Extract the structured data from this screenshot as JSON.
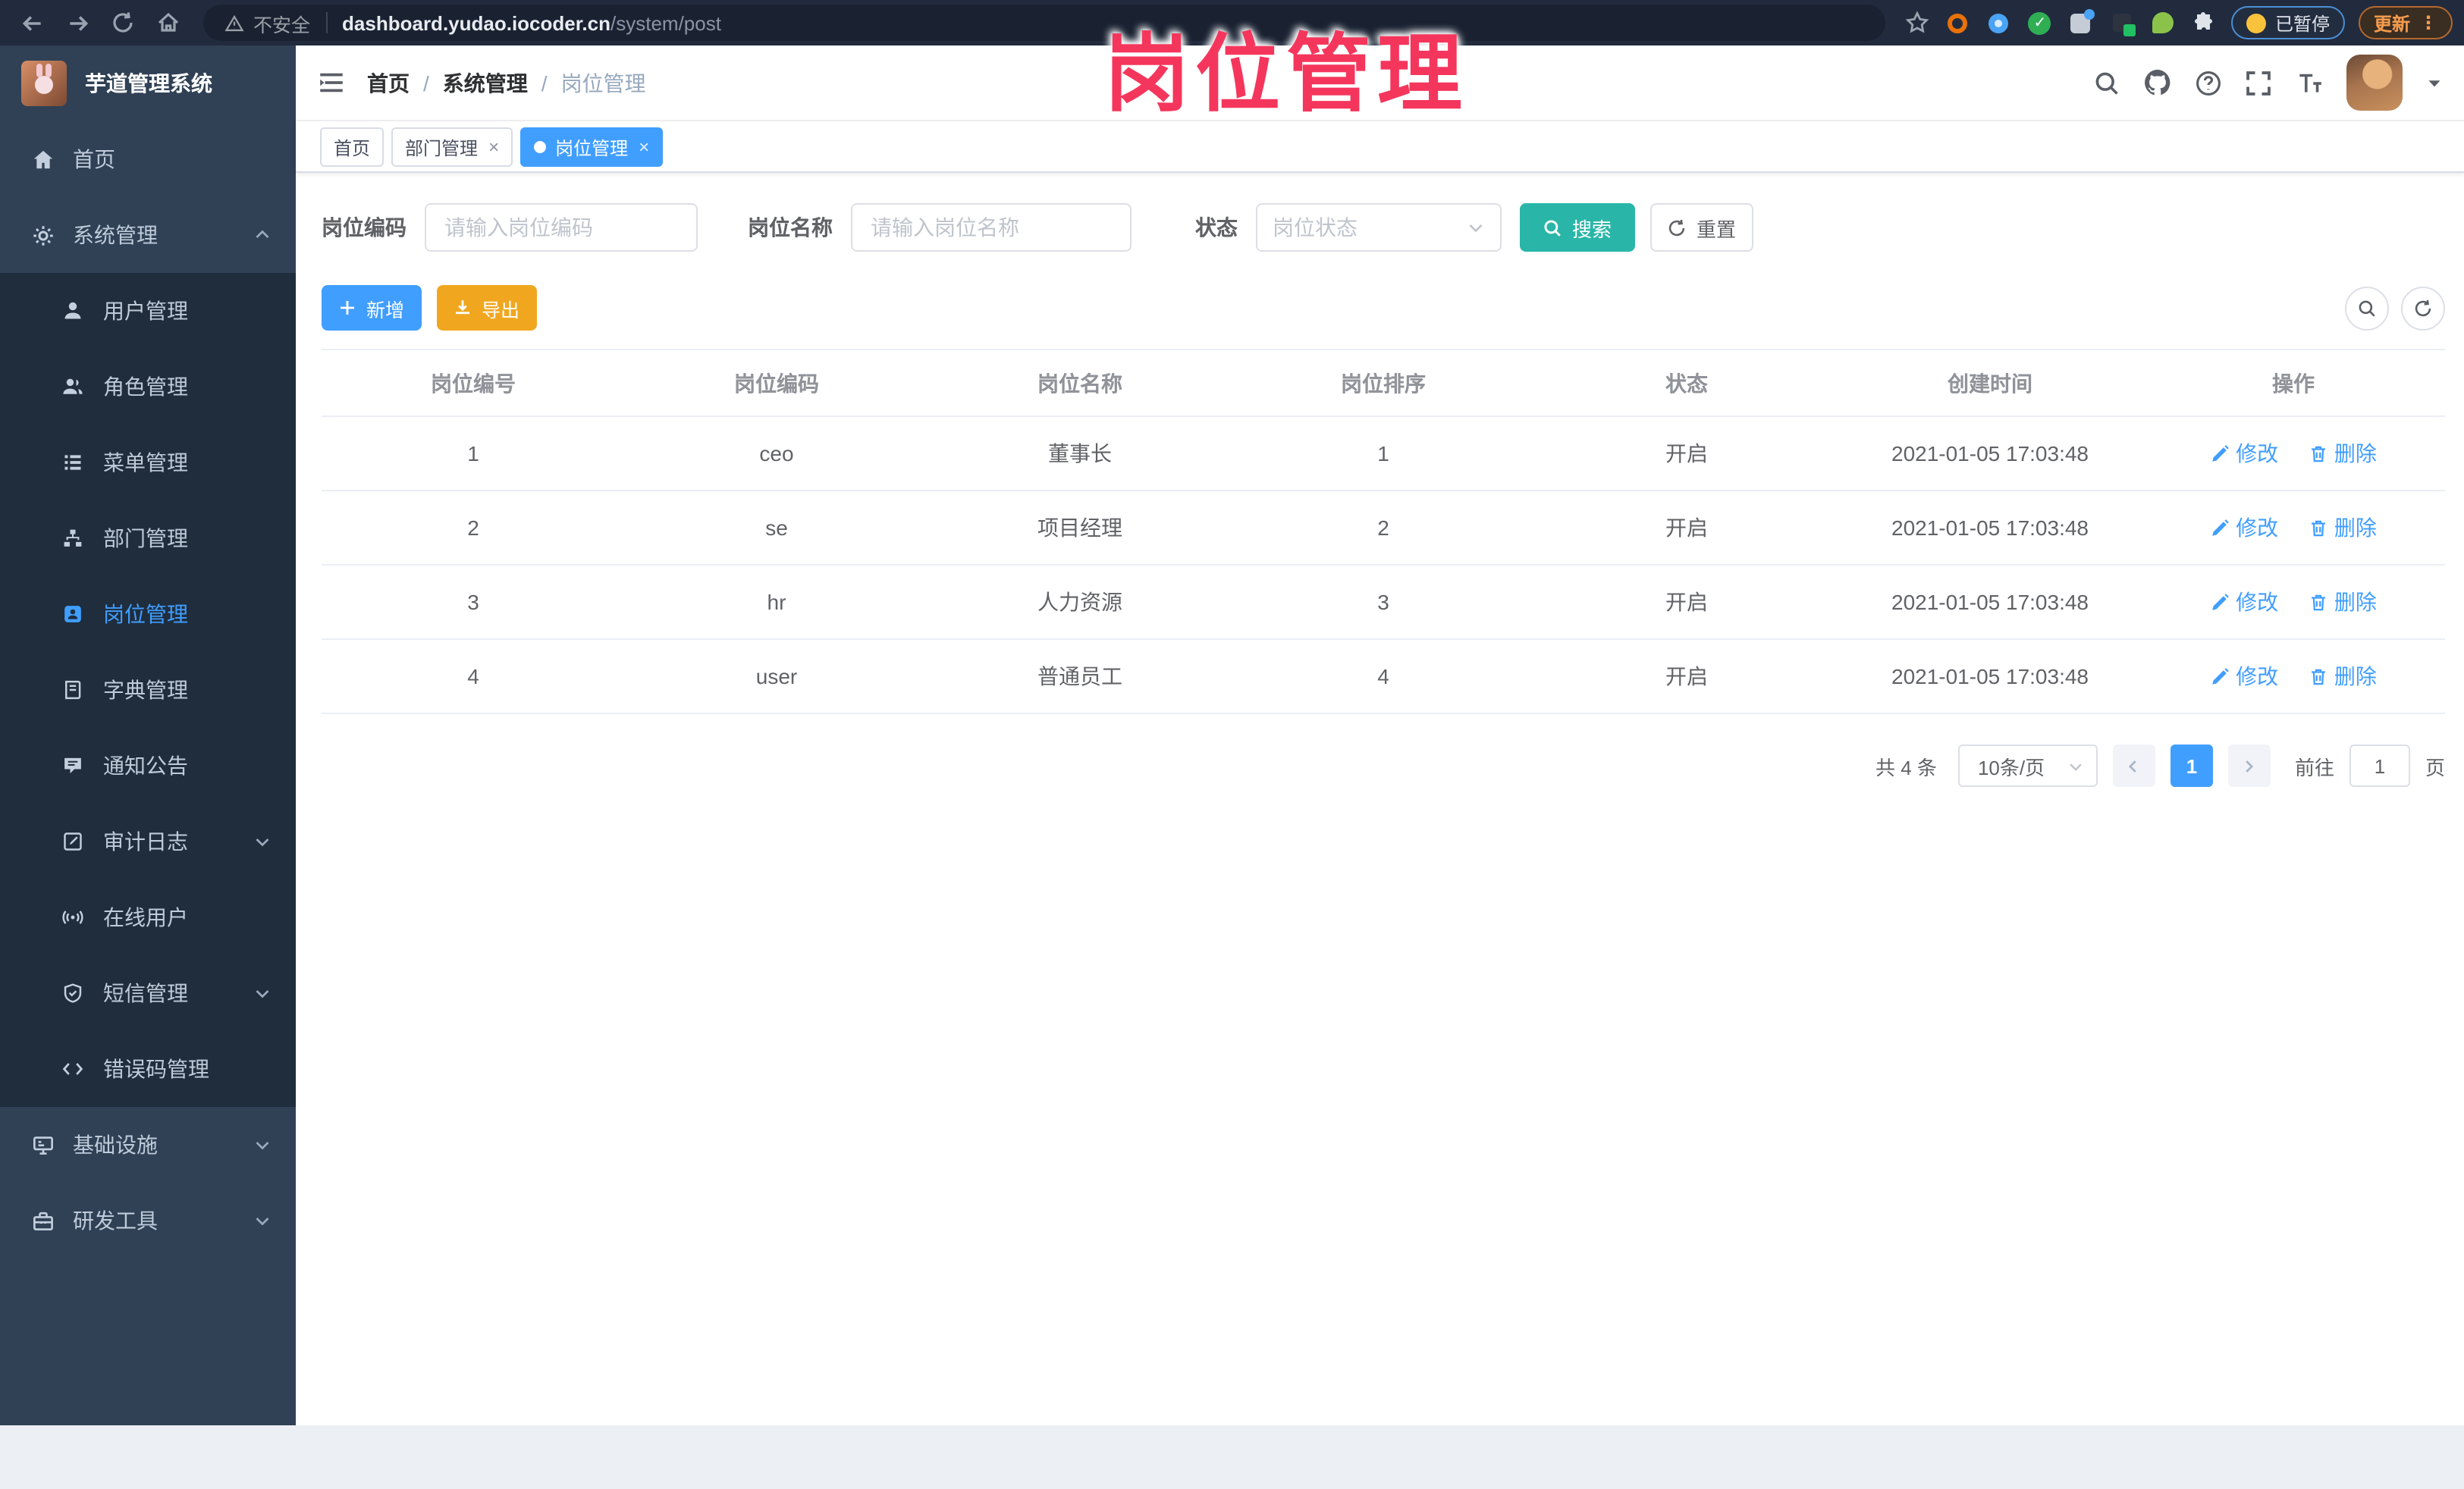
{
  "browser": {
    "security_label": "不安全",
    "url_host": "dashboard.yudao.iocoder.cn",
    "url_path": "/system/post",
    "paused_label": "已暂停",
    "update_label": "更新"
  },
  "annotation": {
    "text": "岗位管理"
  },
  "sidebar": {
    "title": "芋道管理系统",
    "items": [
      {
        "label": "首页"
      },
      {
        "label": "系统管理"
      },
      {
        "label": "用户管理"
      },
      {
        "label": "角色管理"
      },
      {
        "label": "菜单管理"
      },
      {
        "label": "部门管理"
      },
      {
        "label": "岗位管理"
      },
      {
        "label": "字典管理"
      },
      {
        "label": "通知公告"
      },
      {
        "label": "审计日志"
      },
      {
        "label": "在线用户"
      },
      {
        "label": "短信管理"
      },
      {
        "label": "错误码管理"
      },
      {
        "label": "基础设施"
      },
      {
        "label": "研发工具"
      }
    ]
  },
  "breadcrumb": {
    "items": [
      "首页",
      "系统管理",
      "岗位管理"
    ]
  },
  "tabs": [
    {
      "label": "首页"
    },
    {
      "label": "部门管理"
    },
    {
      "label": "岗位管理"
    }
  ],
  "filters": {
    "code_label": "岗位编码",
    "code_placeholder": "请输入岗位编码",
    "name_label": "岗位名称",
    "name_placeholder": "请输入岗位名称",
    "status_label": "状态",
    "status_placeholder": "岗位状态",
    "search_label": "搜索",
    "reset_label": "重置"
  },
  "toolbar": {
    "add_label": "新增",
    "export_label": "导出"
  },
  "table": {
    "headers": [
      "岗位编号",
      "岗位编码",
      "岗位名称",
      "岗位排序",
      "状态",
      "创建时间",
      "操作"
    ],
    "edit_label": "修改",
    "delete_label": "删除",
    "rows": [
      {
        "id": "1",
        "code": "ceo",
        "name": "董事长",
        "sort": "1",
        "status": "开启",
        "created": "2021-01-05 17:03:48"
      },
      {
        "id": "2",
        "code": "se",
        "name": "项目经理",
        "sort": "2",
        "status": "开启",
        "created": "2021-01-05 17:03:48"
      },
      {
        "id": "3",
        "code": "hr",
        "name": "人力资源",
        "sort": "3",
        "status": "开启",
        "created": "2021-01-05 17:03:48"
      },
      {
        "id": "4",
        "code": "user",
        "name": "普通员工",
        "sort": "4",
        "status": "开启",
        "created": "2021-01-05 17:03:48"
      }
    ]
  },
  "pagination": {
    "total_label": "共 4 条",
    "page_size_label": "10条/页",
    "current_page": "1",
    "goto_label": "前往",
    "jump_value": "1",
    "page_unit_label": "页"
  },
  "colors": {
    "primary": "#409eff",
    "warning": "#f0a71f",
    "search_teal": "#29b6a8",
    "annotation_pink": "#f5365c",
    "sidebar_bg": "#304156",
    "submenu_bg": "#1f2d3d"
  }
}
